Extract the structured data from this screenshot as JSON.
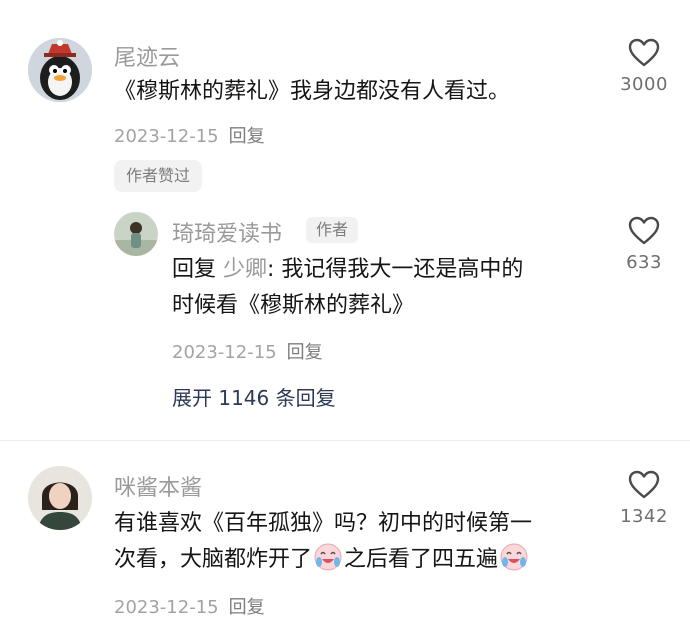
{
  "comments": [
    {
      "username": "尾迹云",
      "text": "《穆斯林的葬礼》我身边都没有人看过。",
      "date": "2023-12-15",
      "reply_label": "回复",
      "likes": "3000",
      "author_liked_badge": "作者赞过"
    },
    {
      "username": "琦琦爱读书",
      "author_tag": "作者",
      "reply_prefix": "回复",
      "reply_target": "少卿",
      "text_line1": ": 我记得我大一还是高中的",
      "text_line2": "时候看《穆斯林的葬礼》",
      "date": "2023-12-15",
      "reply_label": "回复",
      "likes": "633",
      "expand_label": "展开 1146 条回复"
    },
    {
      "username": "咪酱本酱",
      "text_line1": "有谁喜欢《百年孤独》吗？初中的时候第一",
      "text_line2_a": "次看，大脑都炸开了",
      "text_line2_b": "之后看了四五遍",
      "date": "2023-12-15",
      "reply_label": "回复",
      "likes": "1342"
    }
  ],
  "icons": {
    "like": "heart-outline-icon",
    "emoji": "crying-laughing-emoji"
  },
  "colors": {
    "username": "#9a9a9a",
    "text": "#151515",
    "meta": "#a3a3a3",
    "expand": "#2d3a55"
  }
}
